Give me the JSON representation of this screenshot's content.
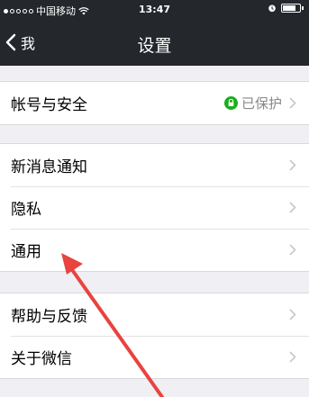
{
  "status_bar": {
    "carrier": "中国移动",
    "time": "13:47"
  },
  "nav": {
    "back_label": "我",
    "title": "设置"
  },
  "settings": {
    "account": {
      "label": "帐号与安全",
      "status": "已保护",
      "status_color": "#1aad19"
    },
    "notifications": {
      "label": "新消息通知"
    },
    "privacy": {
      "label": "隐私"
    },
    "general": {
      "label": "通用"
    },
    "feedback": {
      "label": "帮助与反馈"
    },
    "about": {
      "label": "关于微信"
    }
  },
  "annotation": {
    "arrow_color": "#e8433f",
    "points_to": "general"
  }
}
